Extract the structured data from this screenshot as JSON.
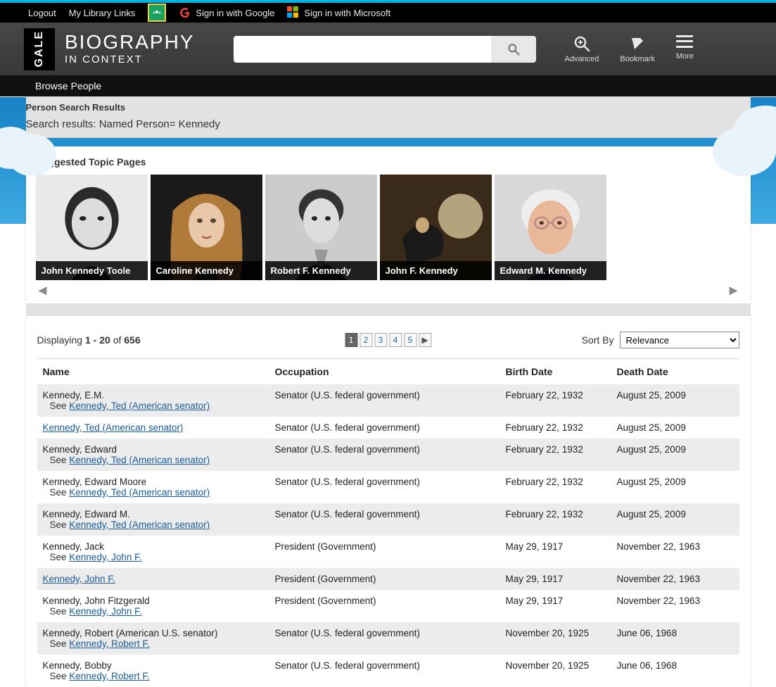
{
  "topbar": {
    "logout": "Logout",
    "library_links": "My Library Links",
    "google": "Sign in with Google",
    "microsoft": "Sign in with Microsoft"
  },
  "brand": {
    "gale": "GALE",
    "title": "BIOGRAPHY",
    "subtitle": "IN CONTEXT"
  },
  "search": {
    "placeholder": ""
  },
  "toolbar": {
    "advanced": "Advanced",
    "bookmark": "Bookmark",
    "more": "More"
  },
  "subnav": {
    "browse": "Browse People"
  },
  "crumb": {
    "heading": "Person Search Results",
    "summary": "Search results: Named Person= Kennedy"
  },
  "topics": {
    "title": "Suggested Topic Pages",
    "cards": [
      {
        "name": "John Kennedy Toole"
      },
      {
        "name": "Caroline Kennedy"
      },
      {
        "name": "Robert F. Kennedy"
      },
      {
        "name": "John F. Kennedy"
      },
      {
        "name": "Edward M. Kennedy"
      }
    ]
  },
  "paging": {
    "displaying": "Displaying",
    "range": "1 - 20",
    "of": "of",
    "total": "656",
    "pages": [
      "1",
      "2",
      "3",
      "4",
      "5"
    ],
    "active": "1"
  },
  "sort": {
    "label": "Sort By",
    "value": "Relevance"
  },
  "columns": {
    "name": "Name",
    "occupation": "Occupation",
    "birth": "Birth Date",
    "death": "Death Date"
  },
  "rows": [
    {
      "name": "Kennedy, E.M.",
      "see": "Kennedy, Ted (American senator)",
      "occ": "Senator (U.S. federal government)",
      "bd": "February 22, 1932",
      "dd": "August 25, 2009",
      "linked": false
    },
    {
      "name": "Kennedy, Ted (American senator)",
      "see": "",
      "occ": "Senator (U.S. federal government)",
      "bd": "February 22, 1932",
      "dd": "August 25, 2009",
      "linked": true
    },
    {
      "name": "Kennedy, Edward",
      "see": "Kennedy, Ted (American senator)",
      "occ": "Senator (U.S. federal government)",
      "bd": "February 22, 1932",
      "dd": "August 25, 2009",
      "linked": false
    },
    {
      "name": "Kennedy, Edward Moore",
      "see": "Kennedy, Ted (American senator)",
      "occ": "Senator (U.S. federal government)",
      "bd": "February 22, 1932",
      "dd": "August 25, 2009",
      "linked": false
    },
    {
      "name": "Kennedy, Edward M.",
      "see": "Kennedy, Ted (American senator)",
      "occ": "Senator (U.S. federal government)",
      "bd": "February 22, 1932",
      "dd": "August 25, 2009",
      "linked": false
    },
    {
      "name": "Kennedy, Jack",
      "see": "Kennedy, John F.",
      "occ": "President (Government)",
      "bd": "May 29, 1917",
      "dd": "November 22, 1963",
      "linked": false
    },
    {
      "name": "Kennedy, John F.",
      "see": "",
      "occ": "President (Government)",
      "bd": "May 29, 1917",
      "dd": "November 22, 1963",
      "linked": true
    },
    {
      "name": "Kennedy, John Fitzgerald",
      "see": "Kennedy, John F.",
      "occ": "President (Government)",
      "bd": "May 29, 1917",
      "dd": "November 22, 1963",
      "linked": false
    },
    {
      "name": "Kennedy, Robert (American U.S. senator)",
      "see": "Kennedy, Robert F.",
      "occ": "Senator (U.S. federal government)",
      "bd": "November 20, 1925",
      "dd": "June 06, 1968",
      "linked": false
    },
    {
      "name": "Kennedy, Bobby",
      "see": "Kennedy, Robert F.",
      "occ": "Senator (U.S. federal government)",
      "bd": "November 20, 1925",
      "dd": "June 06, 1968",
      "linked": false
    }
  ],
  "see_label": "See"
}
